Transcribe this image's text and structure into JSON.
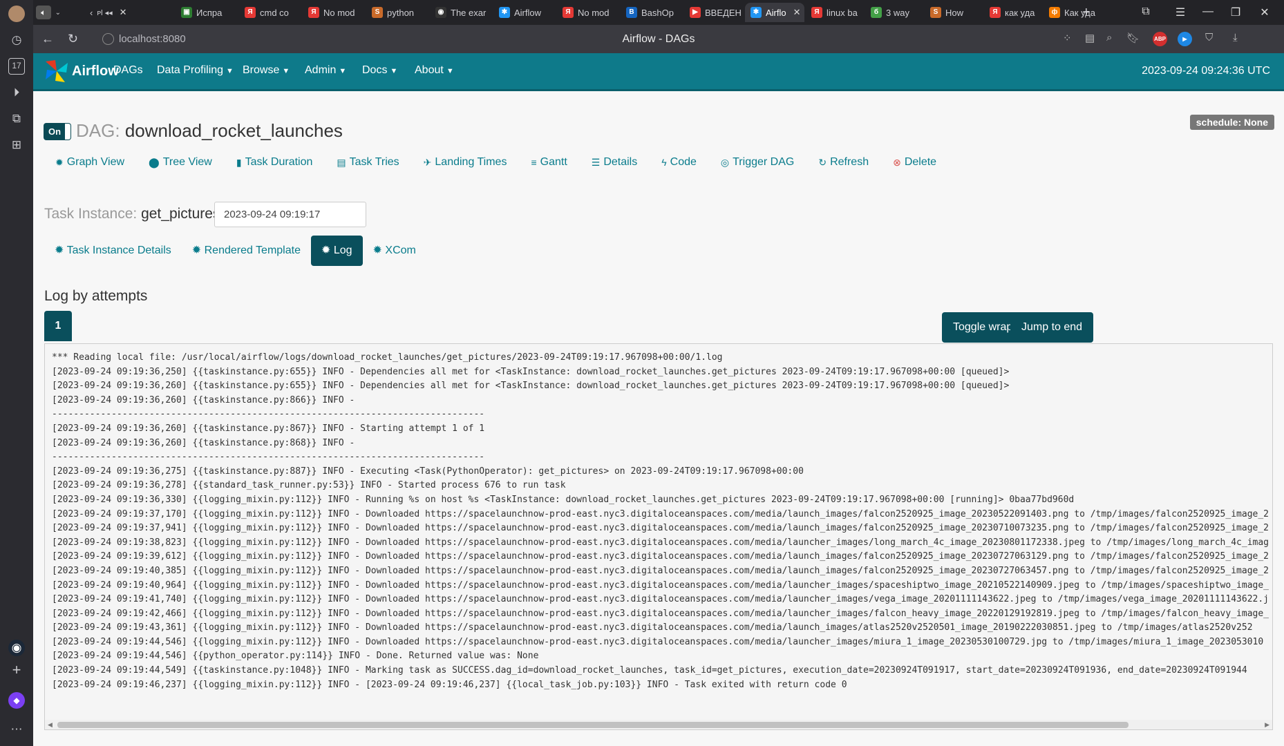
{
  "browser": {
    "tabs": [
      {
        "label": "Испра",
        "color": "#2e7d32",
        "glyph": "▣"
      },
      {
        "label": "cmd co",
        "color": "#e53935",
        "glyph": "Я"
      },
      {
        "label": "No mod",
        "color": "#e53935",
        "glyph": "Я"
      },
      {
        "label": "python",
        "color": "#c96a2a",
        "glyph": "S"
      },
      {
        "label": "The exar",
        "color": "#333333",
        "glyph": "◉"
      },
      {
        "label": "Airflow",
        "color": "#2196f3",
        "glyph": "✱"
      },
      {
        "label": "No mod",
        "color": "#e53935",
        "glyph": "Я"
      },
      {
        "label": "BashOp",
        "color": "#1565c0",
        "glyph": "B"
      },
      {
        "label": "ВВЕДЕН",
        "color": "#e53935",
        "glyph": "▶"
      },
      {
        "label": "Airflo",
        "color": "#2196f3",
        "glyph": "✱",
        "active": true
      },
      {
        "label": "linux ba",
        "color": "#e53935",
        "glyph": "Я"
      },
      {
        "label": "3 way",
        "color": "#43a047",
        "glyph": "б"
      },
      {
        "label": "How",
        "color": "#c96a2a",
        "glyph": "S"
      },
      {
        "label": "как уда",
        "color": "#e53935",
        "glyph": "Я"
      },
      {
        "label": "Как уда",
        "color": "#f57c00",
        "glyph": "ф"
      }
    ],
    "address": "localhost:8080",
    "page_title": "Airflow - DAGs"
  },
  "nav": {
    "logo": "Airflow",
    "menus": [
      "DAGs",
      "Data Profiling",
      "Browse",
      "Admin",
      "Docs",
      "About"
    ],
    "clock": "2023-09-24 09:24:36 UTC"
  },
  "dag": {
    "toggle": "On",
    "prefix": "DAG:",
    "name": "download_rocket_launches",
    "schedule": "schedule: None",
    "links": [
      {
        "label": "Graph View",
        "icon": "✹"
      },
      {
        "label": "Tree View",
        "icon": "⬤"
      },
      {
        "label": "Task Duration",
        "icon": "▮"
      },
      {
        "label": "Task Tries",
        "icon": "▤"
      },
      {
        "label": "Landing Times",
        "icon": "✈"
      },
      {
        "label": "Gantt",
        "icon": "≡"
      },
      {
        "label": "Details",
        "icon": "☰"
      },
      {
        "label": "Code",
        "icon": "ϟ"
      },
      {
        "label": "Trigger DAG",
        "icon": "◎"
      },
      {
        "label": "Refresh",
        "icon": "↻"
      },
      {
        "label": "Delete",
        "icon": "⊗"
      }
    ]
  },
  "task_instance": {
    "prefix": "Task Instance:",
    "name": "get_pictures",
    "date": "2023-09-24 09:19:17",
    "tabs": [
      {
        "label": "Task Instance Details"
      },
      {
        "label": "Rendered Template"
      },
      {
        "label": "Log",
        "active": true
      },
      {
        "label": "XCom"
      }
    ]
  },
  "log": {
    "heading": "Log by attempts",
    "attempt": "1",
    "toggle_wrap": "Toggle wrap",
    "jump_to_end": "Jump to end",
    "lines": [
      "*** Reading local file: /usr/local/airflow/logs/download_rocket_launches/get_pictures/2023-09-24T09:19:17.967098+00:00/1.log",
      "[2023-09-24 09:19:36,250] {{taskinstance.py:655}} INFO - Dependencies all met for <TaskInstance: download_rocket_launches.get_pictures 2023-09-24T09:19:17.967098+00:00 [queued]>",
      "[2023-09-24 09:19:36,260] {{taskinstance.py:655}} INFO - Dependencies all met for <TaskInstance: download_rocket_launches.get_pictures 2023-09-24T09:19:17.967098+00:00 [queued]>",
      "[2023-09-24 09:19:36,260] {{taskinstance.py:866}} INFO - ",
      "--------------------------------------------------------------------------------",
      "[2023-09-24 09:19:36,260] {{taskinstance.py:867}} INFO - Starting attempt 1 of 1",
      "[2023-09-24 09:19:36,260] {{taskinstance.py:868}} INFO - ",
      "--------------------------------------------------------------------------------",
      "[2023-09-24 09:19:36,275] {{taskinstance.py:887}} INFO - Executing <Task(PythonOperator): get_pictures> on 2023-09-24T09:19:17.967098+00:00",
      "[2023-09-24 09:19:36,278] {{standard_task_runner.py:53}} INFO - Started process 676 to run task",
      "[2023-09-24 09:19:36,330] {{logging_mixin.py:112}} INFO - Running %s on host %s <TaskInstance: download_rocket_launches.get_pictures 2023-09-24T09:19:17.967098+00:00 [running]> 0baa77bd960d",
      "[2023-09-24 09:19:37,170] {{logging_mixin.py:112}} INFO - Downloaded https://spacelaunchnow-prod-east.nyc3.digitaloceanspaces.com/media/launch_images/falcon2520925_image_20230522091403.png to /tmp/images/falcon2520925_image_2",
      "[2023-09-24 09:19:37,941] {{logging_mixin.py:112}} INFO - Downloaded https://spacelaunchnow-prod-east.nyc3.digitaloceanspaces.com/media/launch_images/falcon2520925_image_20230710073235.png to /tmp/images/falcon2520925_image_2",
      "[2023-09-24 09:19:38,823] {{logging_mixin.py:112}} INFO - Downloaded https://spacelaunchnow-prod-east.nyc3.digitaloceanspaces.com/media/launcher_images/long_march_4c_image_20230801172338.jpeg to /tmp/images/long_march_4c_imag",
      "[2023-09-24 09:19:39,612] {{logging_mixin.py:112}} INFO - Downloaded https://spacelaunchnow-prod-east.nyc3.digitaloceanspaces.com/media/launch_images/falcon2520925_image_20230727063129.png to /tmp/images/falcon2520925_image_2",
      "[2023-09-24 09:19:40,385] {{logging_mixin.py:112}} INFO - Downloaded https://spacelaunchnow-prod-east.nyc3.digitaloceanspaces.com/media/launch_images/falcon2520925_image_20230727063457.png to /tmp/images/falcon2520925_image_2",
      "[2023-09-24 09:19:40,964] {{logging_mixin.py:112}} INFO - Downloaded https://spacelaunchnow-prod-east.nyc3.digitaloceanspaces.com/media/launcher_images/spaceshiptwo_image_20210522140909.jpeg to /tmp/images/spaceshiptwo_image_",
      "[2023-09-24 09:19:41,740] {{logging_mixin.py:112}} INFO - Downloaded https://spacelaunchnow-prod-east.nyc3.digitaloceanspaces.com/media/launcher_images/vega_image_20201111143622.jpeg to /tmp/images/vega_image_20201111143622.j",
      "[2023-09-24 09:19:42,466] {{logging_mixin.py:112}} INFO - Downloaded https://spacelaunchnow-prod-east.nyc3.digitaloceanspaces.com/media/launcher_images/falcon_heavy_image_20220129192819.jpeg to /tmp/images/falcon_heavy_image_",
      "[2023-09-24 09:19:43,361] {{logging_mixin.py:112}} INFO - Downloaded https://spacelaunchnow-prod-east.nyc3.digitaloceanspaces.com/media/launch_images/atlas2520v2520501_image_20190222030851.jpeg to /tmp/images/atlas2520v252",
      "[2023-09-24 09:19:44,546] {{logging_mixin.py:112}} INFO - Downloaded https://spacelaunchnow-prod-east.nyc3.digitaloceanspaces.com/media/launcher_images/miura_1_image_20230530100729.jpg to /tmp/images/miura_1_image_2023053010",
      "[2023-09-24 09:19:44,546] {{python_operator.py:114}} INFO - Done. Returned value was: None",
      "[2023-09-24 09:19:44,549] {{taskinstance.py:1048}} INFO - Marking task as SUCCESS.dag_id=download_rocket_launches, task_id=get_pictures, execution_date=20230924T091917, start_date=20230924T091936, end_date=20230924T091944",
      "[2023-09-24 09:19:46,237] {{logging_mixin.py:112}} INFO - [2023-09-24 09:19:46,237] {{local_task_job.py:103}} INFO - Task exited with return code 0"
    ]
  },
  "colors": {
    "navbar": "#0e7a8a",
    "accent": "#0a4f5c",
    "link": "#0a7c8c"
  }
}
